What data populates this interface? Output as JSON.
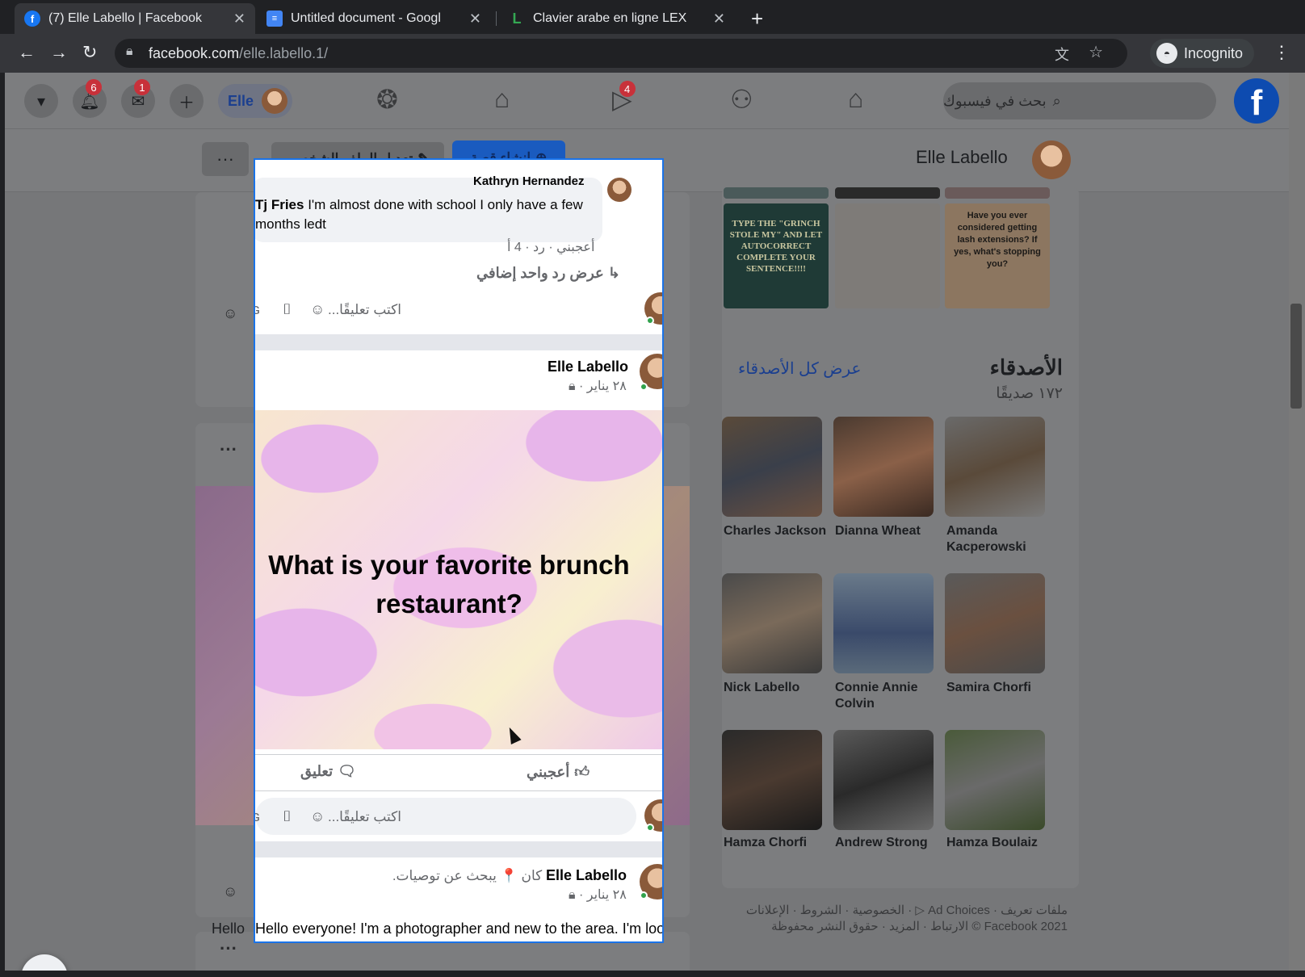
{
  "browser": {
    "tabs": [
      {
        "title": "(7) Elle Labello | Facebook",
        "favicon": "facebook-icon",
        "active": true
      },
      {
        "title": "Untitled document - Googl",
        "favicon": "docs-icon",
        "active": false
      },
      {
        "title": "Clavier arabe en ligne LEX",
        "favicon": "lexilogos-icon",
        "active": false
      }
    ],
    "new_tab": "+",
    "url_host": "facebook.com",
    "url_path": "/elle.labello.1/",
    "incognito_label": "Incognito"
  },
  "fb_header": {
    "notifications_badge": "6",
    "messenger_badge": "1",
    "watch_badge": "4",
    "profile_name": "Elle",
    "search_placeholder": "بحث في فيسبوك"
  },
  "profile_bar": {
    "name": "Elle Labello",
    "edit_profile": "تعديل الملف الشخصي",
    "add_story": "إنشاء قصة",
    "more": "···"
  },
  "panel": {
    "reply_author": "Kathryn Hernandez",
    "reply_commenter": "Tj Fries",
    "reply_text": "I'm almost done with school I only have a few months ledt",
    "reply_actions": "أعجبني · رد · 4 أ",
    "more_replies": "عرض رد واحد إضافي",
    "comment_placeholder": "اكتب تعليقًا...",
    "post1": {
      "author": "Elle Labello",
      "meta": "٢٨ يناير ·",
      "question": "What is your favorite brunch restaurant?",
      "like_label": "أعجبني",
      "comment_label": "تعليق"
    },
    "post2": {
      "author": "Elle Labello",
      "activity": "كان 📍 يبحث عن توصيات.",
      "meta": "٢٨ يناير ·",
      "text": "Hello everyone! I'm a photographer and new to the area. I'm looking"
    }
  },
  "sidebar": {
    "photo_texts": [
      "TYPE THE \"GRINCH STOLE MY\" AND LET AUTOCORRECT COMPLETE YOUR SENTENCE!!!!",
      "Have you ever considered getting lash extensions? If yes, what's stopping you?"
    ],
    "friends_title": "الأصدقاء",
    "friends_count": "١٧٢ صديقًا",
    "see_all": "عرض كل الأصدقاء",
    "friends": [
      "Charles Jackson",
      "Dianna Wheat",
      "Amanda Kacperowski",
      "Nick Labello",
      "Connie Annie Colvin",
      "Samira Chorfi",
      "Hamza Chorfi",
      "Andrew Strong",
      "Hamza Boulaiz"
    ],
    "footer_line1": "الخصوصية · الشروط · الإعلانات · ▷ Ad Choices · ملفات تعريف",
    "footer_line2": "الارتباط · المزيد · حقوق النشر محفوظة © Facebook 2021"
  },
  "left_feed": {
    "dim_text": "Hello"
  }
}
